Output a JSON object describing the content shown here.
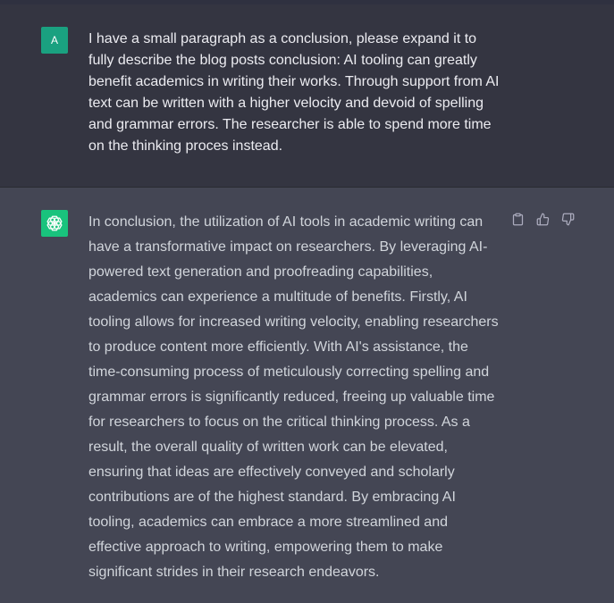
{
  "user_message": {
    "avatar_initial": "A",
    "text": "I have a small paragraph as a conclusion, please expand it to fully describe the blog posts conclusion: AI tooling can greatly benefit academics in writing their works. Through support from AI text can be written with a higher velocity and devoid of spelling and grammar errors. The researcher is able to spend more time on the thinking proces instead."
  },
  "assistant_message": {
    "avatar_icon": "openai-logo-icon",
    "text": "In conclusion, the utilization of AI tools in academic writing can have a transformative impact on researchers. By leveraging AI-powered text generation and proofreading capabilities, academics can experience a multitude of benefits. Firstly, AI tooling allows for increased writing velocity, enabling researchers to produce content more efficiently. With AI's assistance, the time-consuming process of meticulously correcting spelling and grammar errors is significantly reduced, freeing up valuable time for researchers to focus on the critical thinking process. As a result, the overall quality of written work can be elevated, ensuring that ideas are effectively conveyed and scholarly contributions are of the highest standard. By embracing AI tooling, academics can embrace a more streamlined and effective approach to writing, empowering them to make significant strides in their research endeavors.",
    "actions": [
      "copy-icon",
      "thumbs-up-icon",
      "thumbs-down-icon"
    ]
  },
  "colors": {
    "user_bg": "#343541",
    "assistant_bg": "#444654",
    "user_avatar": "#1aa180",
    "assistant_avatar": "#19c37d",
    "text": "#ececf1"
  }
}
